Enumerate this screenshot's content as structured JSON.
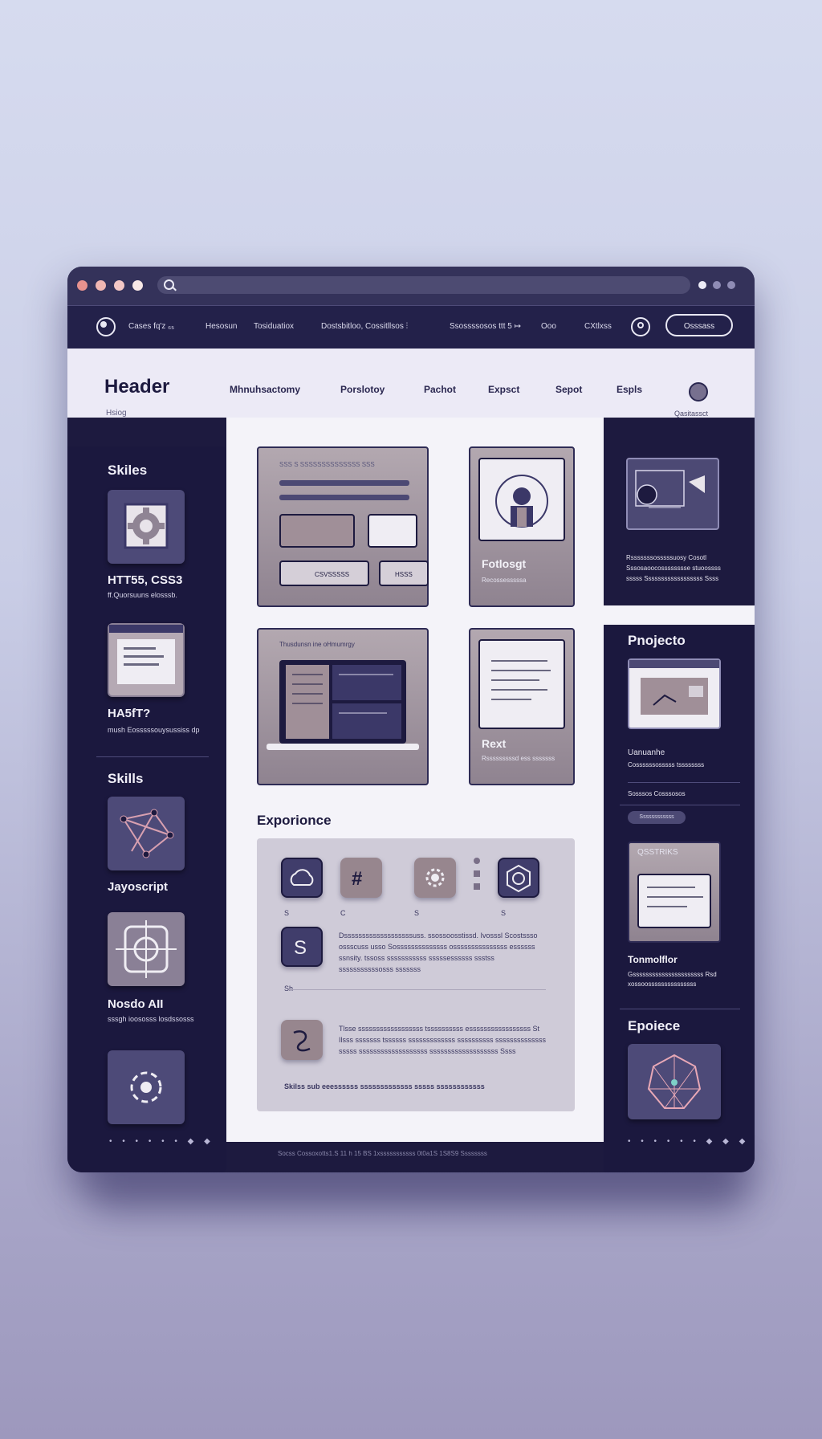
{
  "window": {
    "url": "",
    "traffic_colors": [
      "#e7928f",
      "#f0b6b2",
      "#f3c7c5",
      "#f7e7e5"
    ]
  },
  "navbar": {
    "links": [
      "Cases fq'z ₆₅",
      "Hesosun",
      "Tosiduatiox",
      "Dostsbitloo, Cossitllsos ⫶",
      "Ssossssosos ttt 5 ↦",
      "Ooo",
      "CXtlxss"
    ],
    "button": "Osssass"
  },
  "header": {
    "title": "Header",
    "subtitle": "Hsiog",
    "nav": [
      "Mhnuhsactomy",
      "Porslotoy",
      "Pachot",
      "Expsct",
      "Sepot",
      "Espls"
    ],
    "aux": "Qasitassct"
  },
  "left_sidebar": {
    "title1": "Skiles",
    "skill1_name": "HTT55, CSS3",
    "skill1_desc": "ff.Quorsuuns elosssb.",
    "skill2_name": "HA5fT?",
    "skill2_desc": "mush Eosssssouysussiss dp",
    "title2": "Skills",
    "skill3_name": "Jayoscript",
    "skill4_name": "Nosdo  AII",
    "skill4_desc": "sssgh ioososss losdssosss",
    "dots": "• • • • • • ◆ ◆"
  },
  "cards": {
    "card1_text": "SSS   S     SSSSSSSSSSSSSS     SSS",
    "card1_btn1": "CSVSSSSS",
    "card1_btn2": "HSSS",
    "portfolio_title": "Fotlosgt",
    "portfolio_desc": "Recossesssssa",
    "card3_caption": "Thusdunsn ine oHmumrgy",
    "react_title": "Rext",
    "react_desc": "Rsssssssssd ess sssssss"
  },
  "right_sidebar": {
    "desc1": "Rsssssssosssssuosy Cosotl Sssosaoocosssssssse stuoossss sssss Ssssssssssssssssss Ssss",
    "title1": "Pnojecto",
    "proj_name": "Uanuanhe",
    "proj_desc": "Cossssssosssss tssssssss",
    "proj_link": "Sosssos Cosssosos",
    "proj_tag": "Ssssssssssss",
    "card_title": "QSSTRIKS",
    "title2": "Tonmolflor",
    "desc2": "Gssssssssssssssssssssss Rsd  xossoosssssssssssssss",
    "title3": "Epoiece",
    "dots": "• • • • • • ◆ ◆ ◆"
  },
  "experience": {
    "title": "Exporionce",
    "icon_labels": [
      "S",
      "C",
      "S",
      "S"
    ],
    "row1_text": "Dsssssssssssssssssssuss. ssossoosstissd. Ivosssl Scostssso ossscuss usso Sossssssssssssss osssssssssssssss essssss ssnsity. tssoss sssssssssss sssssessssss ssstss sssssssssssosss sssssss",
    "row1_meta": "Sh",
    "row2_text": "Tlsse ssssssssssssssssss tssssssssss esssssssssssssssss St Ilsss sssssss tssssss sssssssssssss ssssssssss ssssssssssssss sssss sssssssssssssssssss sssssssssssssssssss Ssss",
    "row2_meta": "Skilss sub eeessssss sssssssssssss sssss ssssssssssss"
  },
  "footer": {
    "text": "Socss Cossoxotts1.S 11 h 15 BS 1xsssssssssss 0t0a1S 1S8S9 Ssssssss"
  }
}
